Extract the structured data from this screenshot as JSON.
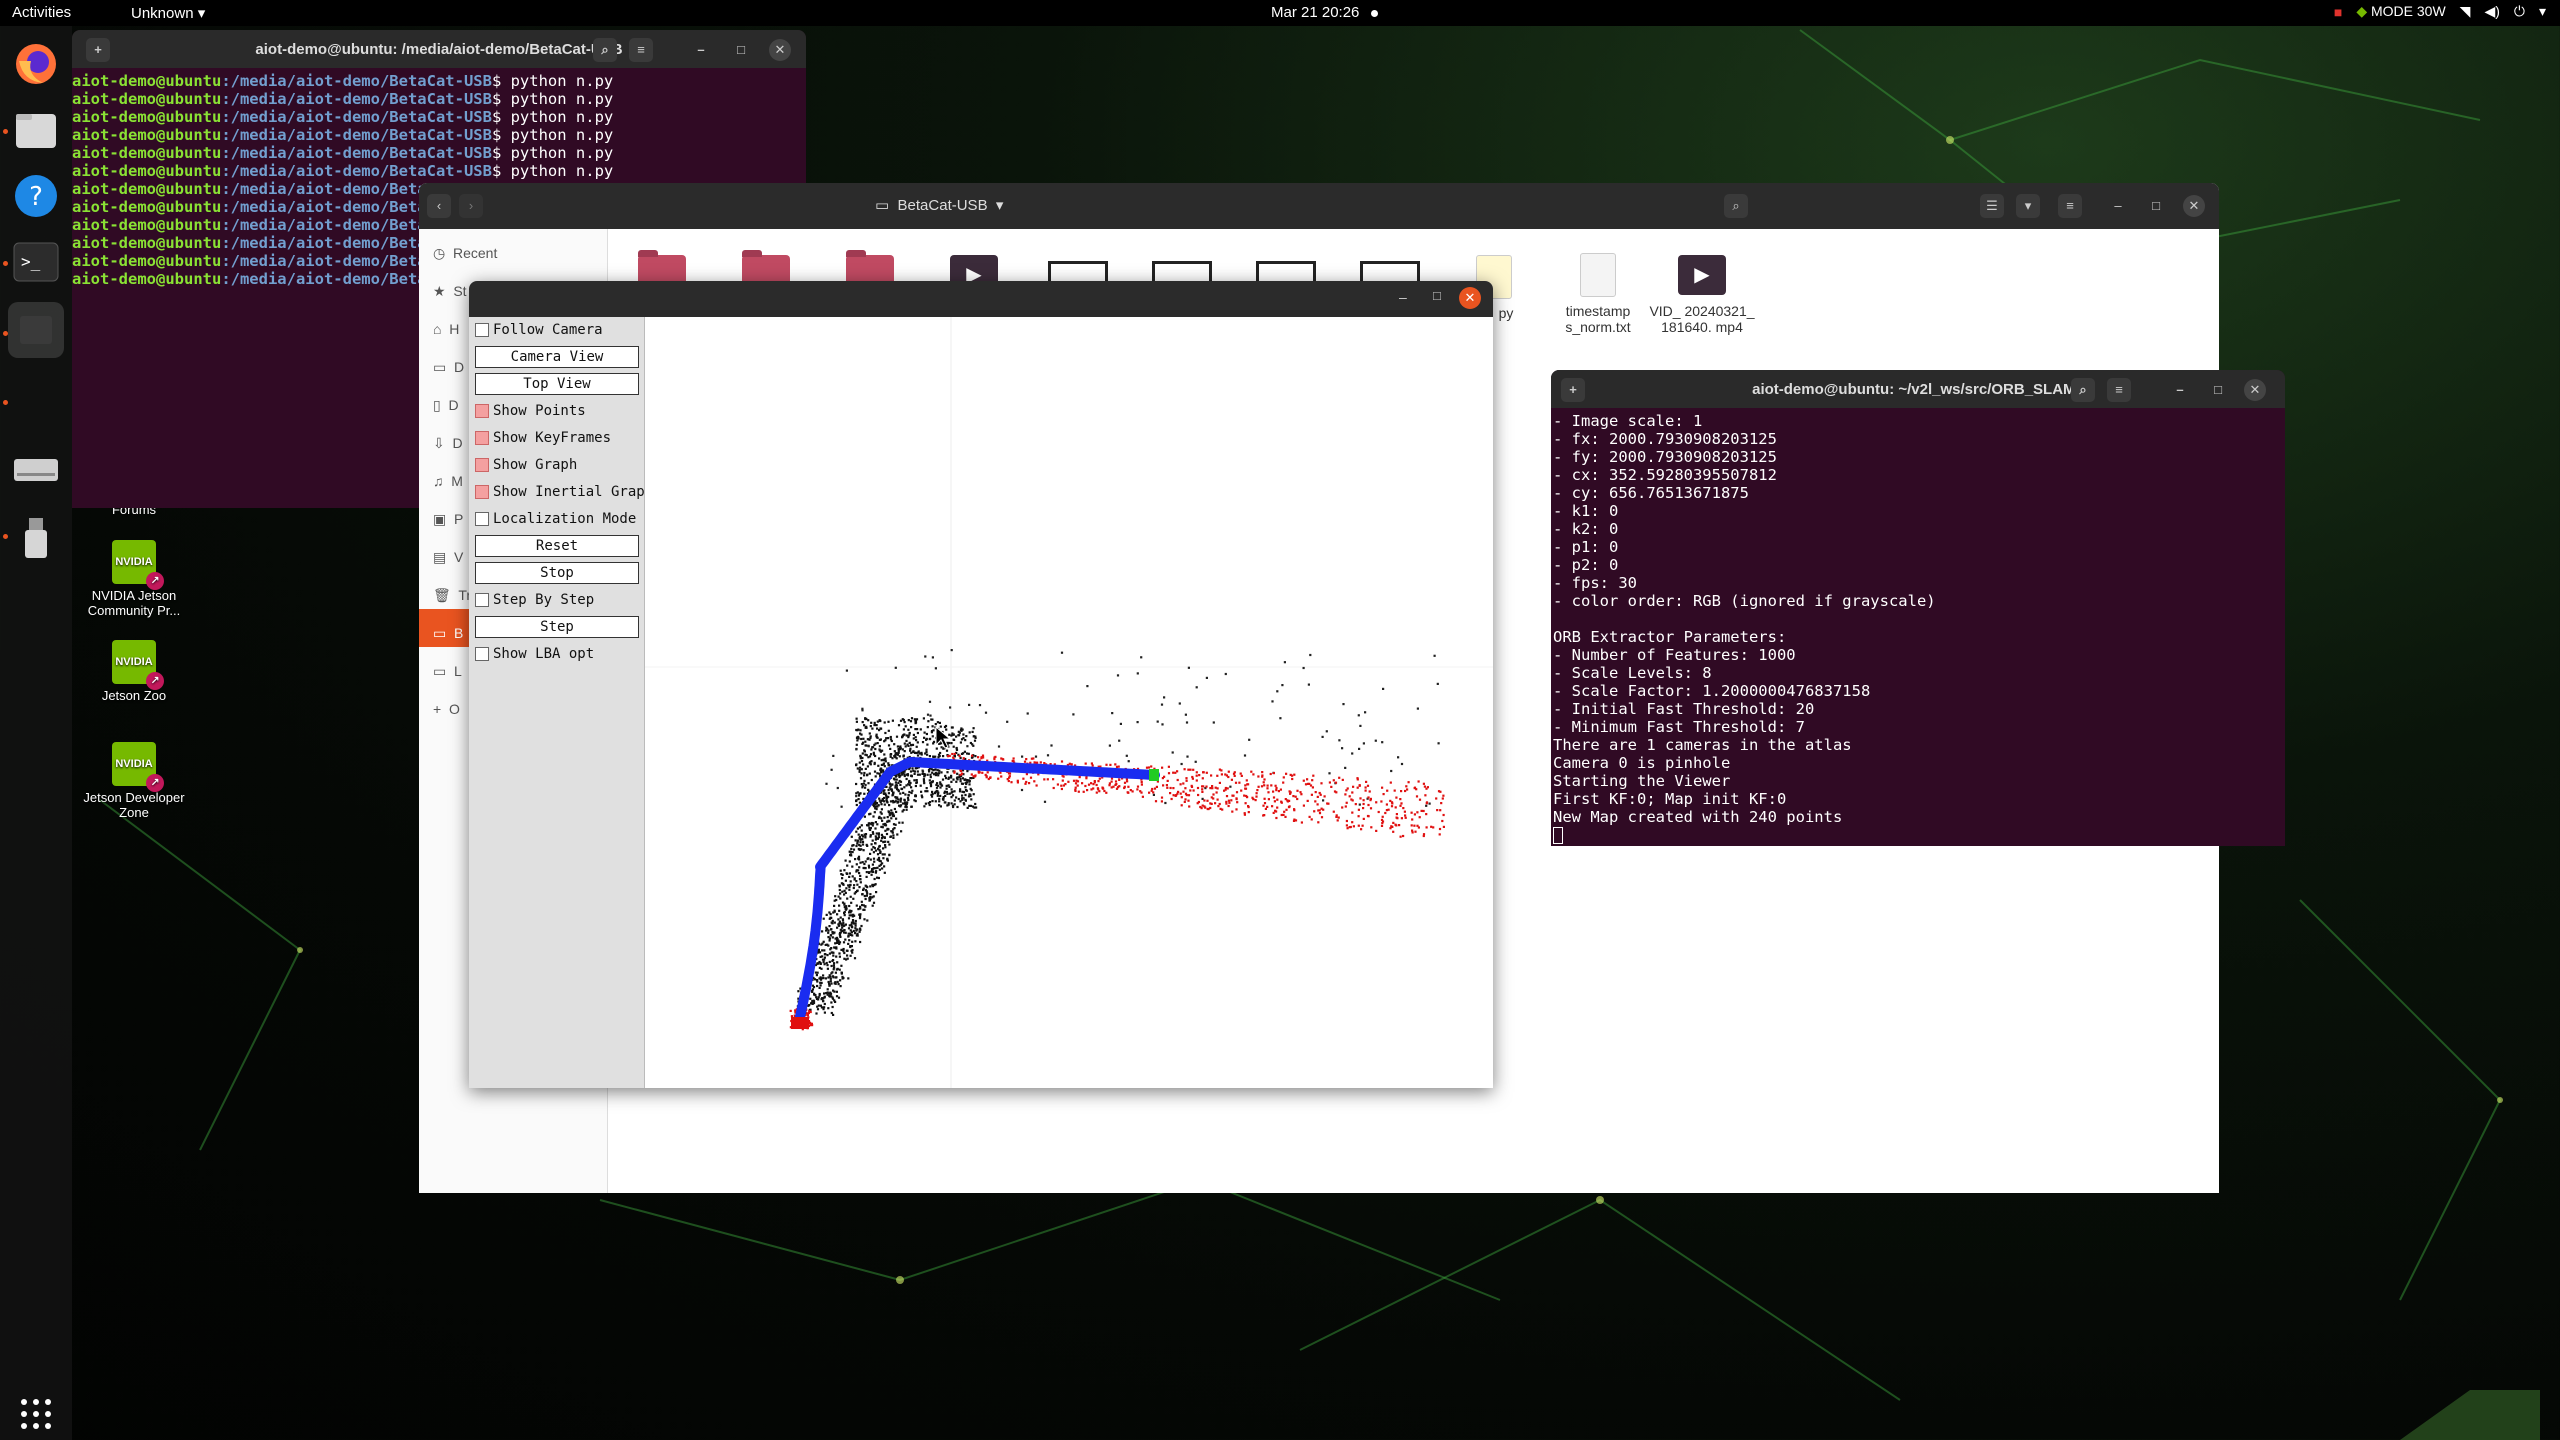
{
  "topbar": {
    "activities": "Activities",
    "app_menu": "Unknown",
    "clock": "Mar 21  20:26",
    "power_mode": "MODE 30W"
  },
  "desktop": {
    "icons": [
      {
        "label": "Forums"
      },
      {
        "label": "NVIDIA Jetson Community Pr..."
      },
      {
        "label": "Jetson Zoo"
      },
      {
        "label": "Jetson Developer Zone"
      }
    ],
    "nvidia_text": "NVIDIA"
  },
  "terminal1": {
    "title": "aiot-demo@ubuntu: /media/aiot-demo/BetaCat-USB",
    "user_host": "aiot-demo@ubuntu",
    "path": ":/media/aiot-demo/BetaCat-USB",
    "path_short": ":/media/aiot-demo/Betac",
    "command": "$ python n.py"
  },
  "files": {
    "location": "BetaCat-USB",
    "sidebar": {
      "recent": "Recent",
      "starred": "St",
      "home": "H",
      "desktop": "D",
      "documents": "D",
      "downloads": "D",
      "music": "M",
      "pictures": "P",
      "videos": "V",
      "trash": "Tr",
      "betacat": "B",
      "locations": "L",
      "other": "O"
    },
    "items": {
      "py_label": "py",
      "timestamp_label": "timestamp s_norm.txt",
      "vid_label": "VID_ 20240321_ 181640. mp4"
    }
  },
  "viewer": {
    "panel": {
      "follow_camera": "Follow Camera",
      "camera_view": "Camera View",
      "top_view": "Top View",
      "show_points": "Show Points",
      "show_keyframes": "Show KeyFrames",
      "show_graph": "Show Graph",
      "show_inertial_graph": "Show Inertial Graph",
      "localization_mode": "Localization Mode",
      "reset": "Reset",
      "stop": "Stop",
      "step_by_step": "Step By Step",
      "step": "Step",
      "show_lba_opt": "Show LBA opt"
    }
  },
  "terminal2": {
    "title": "aiot-demo@ubuntu: ~/v2l_ws/src/ORB_SLAM3",
    "lines": [
      "- Image scale: 1",
      "- fx: 2000.7930908203125",
      "- fy: 2000.7930908203125",
      "- cx: 352.59280395507812",
      "- cy: 656.76513671875",
      "- k1: 0",
      "- k2: 0",
      "- p1: 0",
      "- p2: 0",
      "- fps: 30",
      "- color order: RGB (ignored if grayscale)",
      "",
      "ORB Extractor Parameters:",
      "- Number of Features: 1000",
      "- Scale Levels: 8",
      "- Scale Factor: 1.2000000476837158",
      "- Initial Fast Threshold: 20",
      "- Minimum Fast Threshold: 7",
      "There are 1 cameras in the atlas",
      "Camera 0 is pinhole",
      "Starting the Viewer",
      "First KF:0; Map init KF:0",
      "New Map created with 240 points"
    ]
  },
  "colors": {
    "terminal_bg": "#300a24",
    "ubuntu_orange": "#e95420",
    "prompt_green": "#8ae234",
    "prompt_blue": "#729fcf",
    "keyframe_blue": "#1a2cf0",
    "map_point_red": "#e01010",
    "nvidia_green": "#76b900"
  }
}
